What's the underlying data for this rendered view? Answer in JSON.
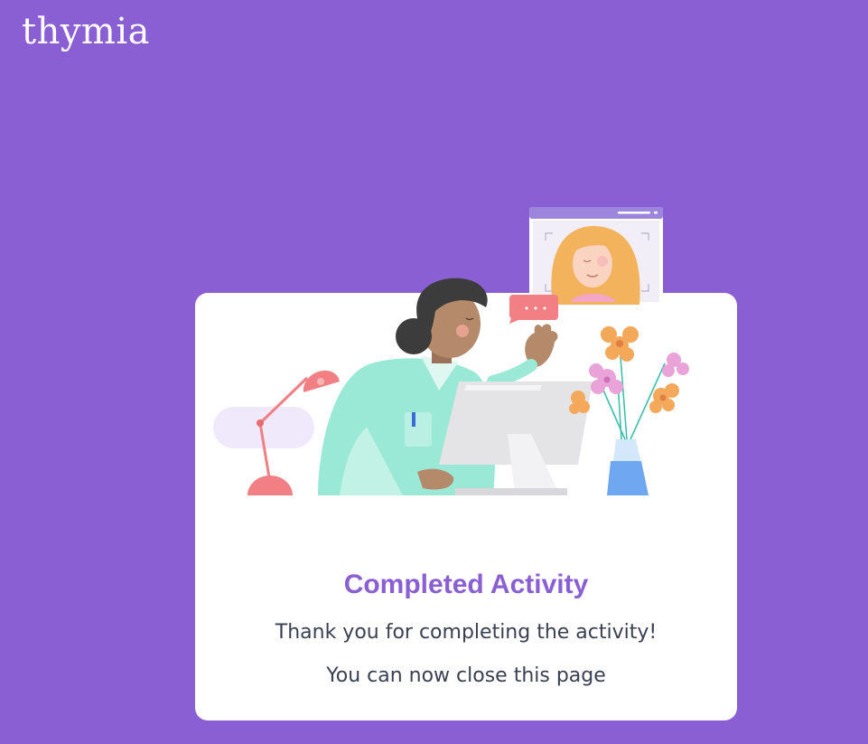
{
  "header": {
    "logo_text": "thymia"
  },
  "completion": {
    "title": "Completed Activity",
    "message": "Thank you for completing the activity!",
    "instruction": "You can now close this page"
  },
  "illustration": {
    "icon": "doctor-video-call-illustration",
    "chat_bubble_text": "• • •"
  },
  "colors": {
    "background": "#8a5fd3",
    "card": "#ffffff",
    "title": "#8a5fd3",
    "text": "#3a3f52"
  }
}
